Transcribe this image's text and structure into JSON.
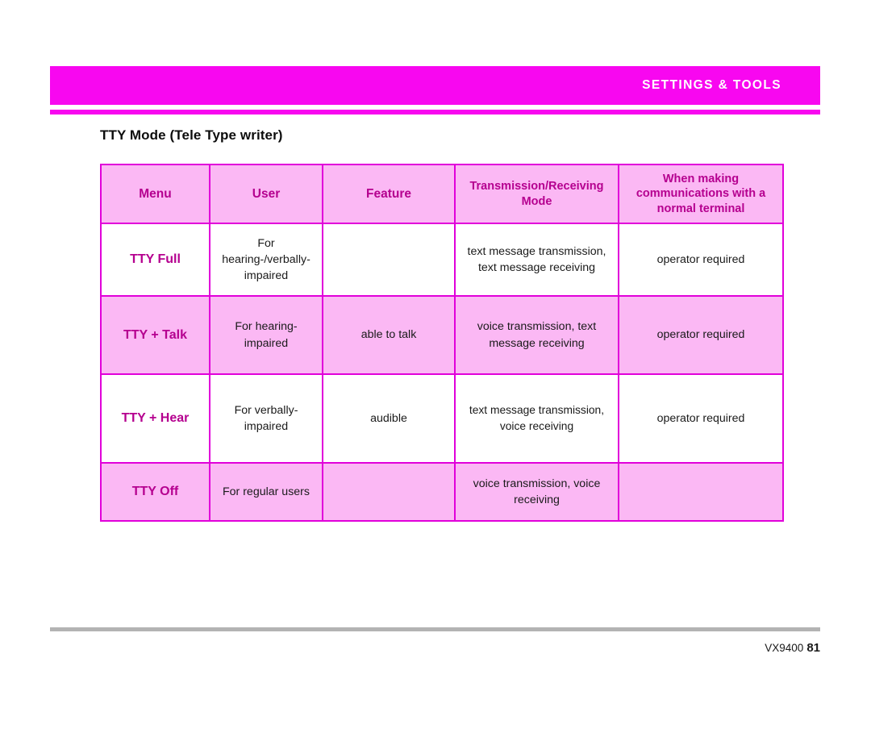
{
  "header": {
    "title": "SETTINGS & TOOLS"
  },
  "section": {
    "title": "TTY Mode (Tele Type writer)"
  },
  "table": {
    "columns": [
      "Menu",
      "User",
      "Feature",
      "Transmission/Receiving Mode",
      "When making communications with a normal terminal"
    ],
    "rows": [
      {
        "menu": "TTY Full",
        "user": "For hearing-/verbally-impaired",
        "feature": "",
        "mode": "text message transmission, text message receiving",
        "when": "operator required"
      },
      {
        "menu": "TTY + Talk",
        "user": "For hearing-impaired",
        "feature": "able to talk",
        "mode": "voice transmission, text message receiving",
        "when": "operator required"
      },
      {
        "menu": "TTY + Hear",
        "user": "For verbally-impaired",
        "feature": "audible",
        "mode": "text message transmission, voice receiving",
        "when": "operator required"
      },
      {
        "menu": "TTY Off",
        "user": "For regular users",
        "feature": "",
        "mode": "voice transmission, voice receiving",
        "when": ""
      }
    ]
  },
  "footer": {
    "model": "VX9400",
    "page_number": "81"
  },
  "colors": {
    "accent": "#f807f0",
    "header_cell": "#fbb8f4",
    "border": "#e100da",
    "menu_text": "#b5008f",
    "footer_rule": "#b3b3b3"
  }
}
